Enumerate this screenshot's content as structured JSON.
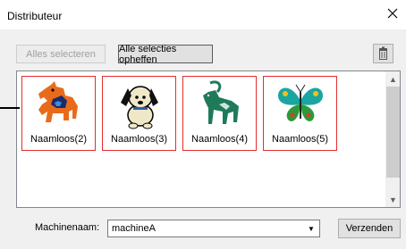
{
  "window": {
    "title": "Distributeur"
  },
  "toolbar": {
    "select_all": "Alles selecteren",
    "deselect_all": "Alle selecties opheffen",
    "delete_icon": "trash-icon"
  },
  "items": [
    {
      "name": "Naamloos(2)",
      "icon": "horse-embroidery"
    },
    {
      "name": "Naamloos(3)",
      "icon": "dog-embroidery"
    },
    {
      "name": "Naamloos(4)",
      "icon": "ibex-embroidery"
    },
    {
      "name": "Naamloos(5)",
      "icon": "butterfly-embroidery"
    }
  ],
  "machine": {
    "label": "Machinenaam:",
    "value": "machineA",
    "send_label": "Verzenden"
  },
  "colors": {
    "selection_border": "#e12e2e",
    "window_bg": "#f0f0f0"
  }
}
